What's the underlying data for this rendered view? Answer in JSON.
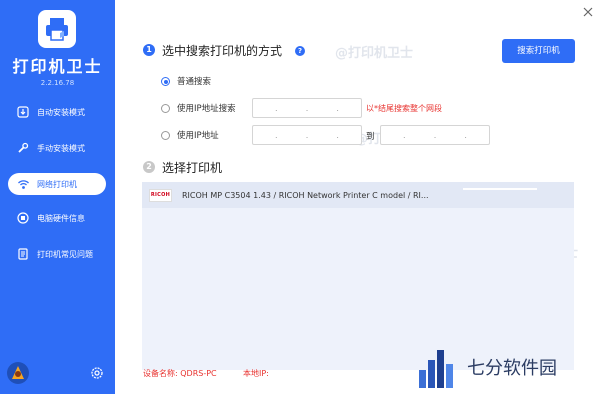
{
  "app": {
    "title": "打印机卫士",
    "version": "2.2.16.78"
  },
  "sidebar": {
    "items": [
      {
        "label": "自动安装模式",
        "icon": "download-box-icon",
        "active": false
      },
      {
        "label": "手动安装模式",
        "icon": "wrench-icon",
        "active": false
      },
      {
        "label": "网络打印机",
        "icon": "network-printer-icon",
        "active": true
      },
      {
        "label": "电脑硬件信息",
        "icon": "hardware-icon",
        "active": false
      },
      {
        "label": "打印机常见问题",
        "icon": "faq-book-icon",
        "active": false
      }
    ]
  },
  "section1": {
    "number": "1",
    "title": "选中搜索打印机的方式",
    "help": "?",
    "search_button": "搜索打印机",
    "options": [
      {
        "label": "普通搜索",
        "checked": true
      },
      {
        "label": "使用IP地址搜索",
        "checked": false,
        "hint": "以*结尾搜索整个网段"
      },
      {
        "label": "使用IP地址",
        "checked": false,
        "to": "到"
      }
    ],
    "ip_dots": [
      ".",
      ".",
      "."
    ]
  },
  "section2": {
    "number": "2",
    "title": "选择打印机",
    "printers": [
      {
        "brand": "RICOH",
        "name": "RICOH MP C3504 1.43 / RICOH Network Printer C model / RI..."
      }
    ]
  },
  "footer": {
    "device_label": "设备名称: QDRS-PC",
    "ip_label": "本地IP:"
  },
  "watermark": "@打印机卫士",
  "brand": {
    "text": "七分软件园"
  },
  "colors": {
    "primary": "#2f6df6",
    "hint_red": "#e8322f",
    "list_bg": "#eef2fb"
  }
}
